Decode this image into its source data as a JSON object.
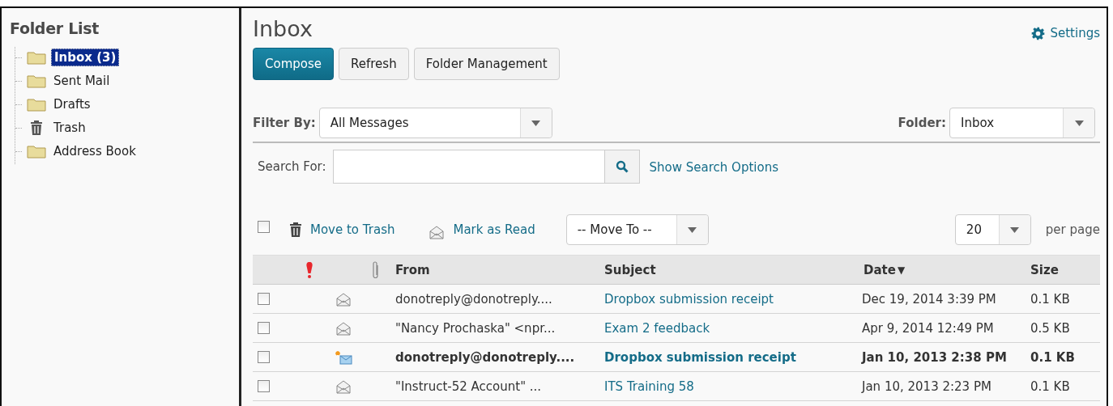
{
  "sidebar": {
    "title": "Folder List",
    "items": [
      {
        "label": "Inbox (3)",
        "kind": "folder",
        "selected": true
      },
      {
        "label": "Sent Mail",
        "kind": "folder",
        "selected": false
      },
      {
        "label": "Drafts",
        "kind": "folder",
        "selected": false
      },
      {
        "label": "Trash",
        "kind": "trash",
        "selected": false
      },
      {
        "label": "Address Book",
        "kind": "folder",
        "selected": false
      }
    ]
  },
  "page": {
    "title": "Inbox",
    "settings": "Settings"
  },
  "toolbar": [
    {
      "label": "Compose",
      "kind": "primary"
    },
    {
      "label": "Refresh",
      "kind": "normal"
    },
    {
      "label": "Folder Management",
      "kind": "normal"
    }
  ],
  "filter": {
    "label": "Filter By:",
    "value": "All Messages"
  },
  "folder": {
    "label": "Folder:",
    "value": "Inbox"
  },
  "search": {
    "label": "Search For:",
    "link": "Show Search Options"
  },
  "actions": {
    "select_all_checked": false,
    "move_to_trash": "Move to Trash",
    "mark_as_read": "Mark as Read",
    "move_to": "-- Move To --",
    "per_page_value": "20",
    "per_page_label": "per page"
  },
  "table": {
    "columns": [
      "From",
      "Subject",
      "Date",
      "Size"
    ],
    "sort_mark": "▼",
    "rows": [
      {
        "from": "donotreply@donotreply....",
        "subject": "Dropbox submission receipt",
        "date": "Dec 19, 2014 3:39 PM",
        "size": "0.1 KB",
        "unread": false,
        "checked": false
      },
      {
        "from": "\"Nancy Prochaska\" <npr...",
        "subject": "Exam 2 feedback",
        "date": "Apr 9, 2014 12:49 PM",
        "size": "0.5 KB",
        "unread": false,
        "checked": false
      },
      {
        "from": "donotreply@donotreply....",
        "subject": "Dropbox submission receipt",
        "date": "Jan 10, 2013 2:38 PM",
        "size": "0.1 KB",
        "unread": true,
        "checked": false
      },
      {
        "from": "\"Instruct-52 Account\" ...",
        "subject": "ITS Training 58",
        "date": "Jan 10, 2013 2:23 PM",
        "size": "0.1 KB",
        "unread": false,
        "checked": false
      }
    ]
  }
}
